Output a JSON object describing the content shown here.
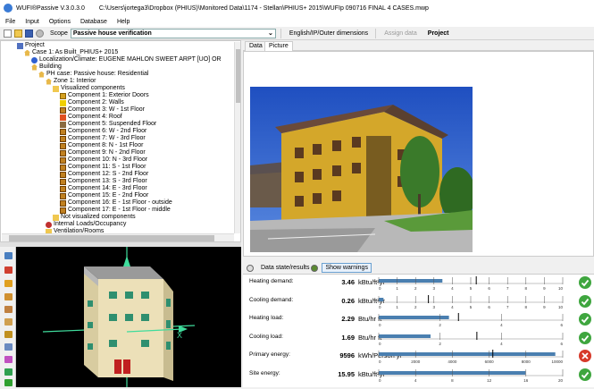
{
  "window": {
    "app_title": "WUFI®Passive V.3.0.3.0",
    "file_path": "C:\\Users\\jortega3\\Dropbox (PHIUS)\\Monitored Data\\1174 - Stellan\\PHIUS+ 2015\\WUFIp 090716 FINAL 4 CASES.mwp"
  },
  "menu": [
    "File",
    "Input",
    "Options",
    "Database",
    "Help"
  ],
  "toolbar": {
    "scope_label": "Scope",
    "scope_value": "Passive house verification",
    "units_button": "English/IP/Outer dimensions",
    "assign_data_button": "Assign data",
    "project_button": "Project"
  },
  "tree": [
    {
      "label": "Project",
      "icon": "project-icon",
      "indent": 0
    },
    {
      "label": "Case 1: As Built_PHIUS+ 2015",
      "icon": "house-icon",
      "indent": 1
    },
    {
      "label": "Localization/Climate: EUGENE MAHLON SWEET ARPT [UO] OR",
      "icon": "globe-icon",
      "indent": 2
    },
    {
      "label": "Building",
      "icon": "house-icon",
      "indent": 2
    },
    {
      "label": "PH case: Passive house: Residential",
      "icon": "house-icon",
      "indent": 3
    },
    {
      "label": "Zone 1: Interior",
      "icon": "house-icon",
      "indent": 4
    },
    {
      "label": "Visualized components",
      "icon": "folder-icon",
      "indent": 5
    },
    {
      "label": "Component 1: Exterior Doors",
      "icon": "door-icon",
      "indent": 6
    },
    {
      "label": "Component 2: Walls",
      "icon": "wall-icon",
      "indent": 6
    },
    {
      "label": "Component 3: W - 1st Floor",
      "icon": "window-icon",
      "indent": 6
    },
    {
      "label": "Component 4: Roof",
      "icon": "roof-icon",
      "indent": 6
    },
    {
      "label": "Component 5: Suspended Floor",
      "icon": "floor-icon",
      "indent": 6
    },
    {
      "label": "Component 6: W - 2nd Floor",
      "icon": "window-icon",
      "indent": 6
    },
    {
      "label": "Component 7: W - 3rd Floor",
      "icon": "window-icon",
      "indent": 6
    },
    {
      "label": "Component 8: N - 1st Floor",
      "icon": "window-icon",
      "indent": 6
    },
    {
      "label": "Component 9: N - 2nd Floor",
      "icon": "window-icon",
      "indent": 6
    },
    {
      "label": "Component 10: N - 3rd Floor",
      "icon": "window-icon",
      "indent": 6
    },
    {
      "label": "Component 11: S - 1st Floor",
      "icon": "window-icon",
      "indent": 6
    },
    {
      "label": "Component 12: S - 2nd Floor",
      "icon": "window-icon",
      "indent": 6
    },
    {
      "label": "Component 13: S - 3rd Floor",
      "icon": "window-icon",
      "indent": 6
    },
    {
      "label": "Component 14: E - 3rd Floor",
      "icon": "window-icon",
      "indent": 6
    },
    {
      "label": "Component 15: E - 2nd Floor",
      "icon": "window-icon",
      "indent": 6
    },
    {
      "label": "Component 16: E - 1st Floor - outside",
      "icon": "window-icon",
      "indent": 6
    },
    {
      "label": "Component 17: E - 1st Floor - middle",
      "icon": "window-icon",
      "indent": 6
    },
    {
      "label": "Not visualized components",
      "icon": "folder-icon",
      "indent": 5
    },
    {
      "label": "Internal Loads/Occupancy",
      "icon": "loads-icon",
      "indent": 4
    },
    {
      "label": "Ventilation/Rooms",
      "icon": "folder-icon",
      "indent": 4
    }
  ],
  "tabs": [
    "Data",
    "Picture"
  ],
  "active_tab": "Picture",
  "results_header": {
    "data_state_label": "Data state/results",
    "warnings_button": "Show warnings"
  },
  "results": [
    {
      "label": "Heating demand:",
      "value": "3.46",
      "unit": "kBtu/ft²yr",
      "bar": 3.46,
      "max": 10,
      "ticks": [
        0,
        1,
        2,
        3,
        4,
        5,
        6,
        7,
        8,
        9,
        10
      ],
      "limit": 5.3,
      "status": "ok"
    },
    {
      "label": "Cooling demand:",
      "value": "0.26",
      "unit": "kBtu/ft²yr",
      "bar": 0.26,
      "max": 10,
      "ticks": [
        0,
        1,
        2,
        3,
        4,
        5,
        6,
        7,
        8,
        9,
        10
      ],
      "limit": 2.7,
      "status": "ok"
    },
    {
      "label": "Heating load:",
      "value": "2.29",
      "unit": "Btu/hr ft²",
      "bar": 2.29,
      "max": 6,
      "ticks": [
        0,
        2,
        4,
        6
      ],
      "limit": 2.6,
      "status": "ok"
    },
    {
      "label": "Cooling load:",
      "value": "1.69",
      "unit": "Btu/hr ft²",
      "bar": 1.69,
      "max": 6,
      "ticks": [
        0,
        2,
        4,
        6
      ],
      "limit": 3.2,
      "status": "ok"
    },
    {
      "label": "Primary energy:",
      "value": "9596",
      "unit": "kWh/Person yr",
      "bar": 9596,
      "max": 10000,
      "ticks": [
        0,
        2000,
        4000,
        6000,
        8000,
        10000
      ],
      "limit": 6200,
      "status": "bad"
    },
    {
      "label": "Site energy:",
      "value": "15.95",
      "unit": "kBtu/ft²yr",
      "bar": 15.95,
      "max": 20,
      "ticks": [
        0,
        4,
        8,
        12,
        16,
        20
      ],
      "limit": null,
      "status": "ok"
    }
  ],
  "colors": {
    "bar": "#4a7fb0",
    "ok": "#3fa63f",
    "bad": "#d63a2a"
  }
}
